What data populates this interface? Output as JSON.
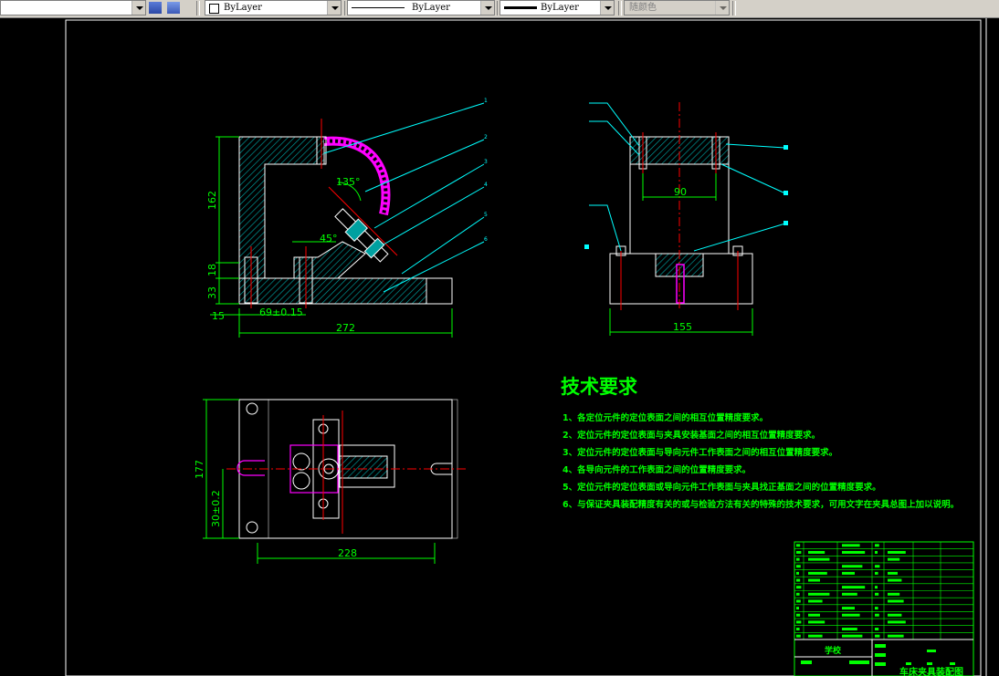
{
  "toolbar": {
    "layer_color_label": "ByLayer",
    "linetype_label": "ByLayer",
    "lineweight_label": "ByLayer",
    "plotstyle_label": "随颜色"
  },
  "drawing": {
    "dims_front": {
      "height": "162",
      "d18": "18",
      "d33": "33",
      "d15": "15",
      "d69": "69±0.15",
      "width": "272",
      "angle1": "135°",
      "angle2": "45°"
    },
    "dims_side": {
      "d90": "90",
      "width": "155"
    },
    "dims_top": {
      "height": "177",
      "d30": "30±0.2",
      "width": "228"
    },
    "tech_title": "技术要求",
    "tech_notes": [
      "1、各定位元件的定位表面之间的相互位置精度要求。",
      "2、定位元件的定位表面与夹具安装基面之间的相互位置精度要求。",
      "3、定位元件的定位表面与导向元件工作表面之间的相互位置精度要求。",
      "4、各导向元件的工作表面之间的位置精度要求。",
      "5、定位元件的定位表面或导向元件工作表面与夹具找正基面之间的位置精度要求。",
      "6、与保证夹具装配精度有关的或与检验方法有关的特殊的技术要求，可用文字在夹具总图上加以说明。"
    ],
    "title_block": {
      "school": "学校",
      "drawing_name": "车床夹具装配图"
    }
  },
  "colors": {
    "green": "#00ff00",
    "cyan": "#00ffff",
    "red": "#ff0000",
    "magenta": "#ff00ff",
    "white": "#ffffff",
    "hatch": "#00a0a0"
  }
}
